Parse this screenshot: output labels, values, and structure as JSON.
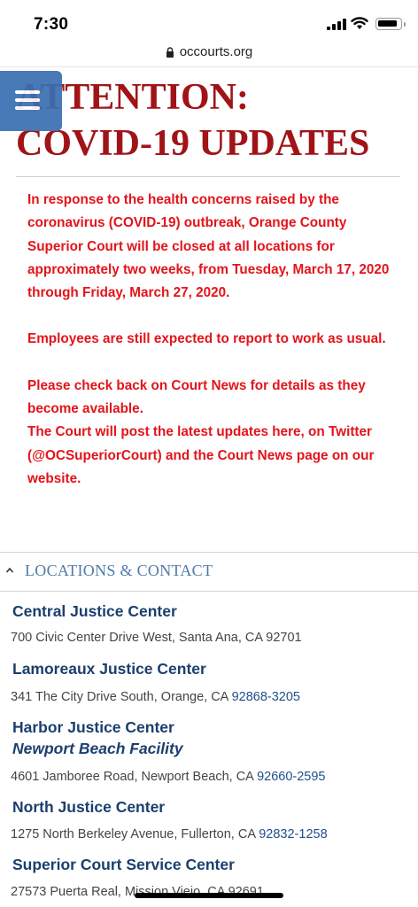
{
  "status_bar": {
    "time": "7:30"
  },
  "browser": {
    "url": "occourts.org"
  },
  "headline": {
    "line1": "ATTENTION:",
    "line2": "COVID-19 UPDATES"
  },
  "notice": {
    "paragraph1": "In response to the health concerns raised by the coronavirus (COVID-19) outbreak, Orange County Superior Court will be closed at all locations for approximately two weeks, from Tuesday, March 17, 2020 through Friday, March 27, 2020.",
    "paragraph2": "Employees are still expected to report to work as usual.",
    "paragraph3": "Please check back on Court News for details as they become available.",
    "paragraph4": "The Court will post the latest updates here, on Twitter (@OCSuperiorCourt) and the Court News page on our website."
  },
  "locations": {
    "title": "LOCATIONS & CONTACT",
    "items": [
      {
        "name": "Central Justice Center",
        "address": "700 Civic Center Drive West, Santa Ana, CA 92701",
        "zip_link": ""
      },
      {
        "name": "Lamoreaux Justice Center",
        "address": "341 The City Drive South, Orange, CA ",
        "zip_link": "92868-3205"
      },
      {
        "name": "Harbor Justice Center",
        "subtitle": "Newport Beach Facility",
        "address": "4601 Jamboree Road, Newport Beach, CA ",
        "zip_link": "92660-2595"
      },
      {
        "name": "North Justice Center",
        "address": "1275 North Berkeley Avenue, Fullerton, CA ",
        "zip_link": "92832-1258"
      },
      {
        "name": "Superior Court Service Center",
        "address": "27573 Puerta Real, Mission Viejo, CA 92691",
        "zip_link": ""
      }
    ]
  },
  "colors": {
    "headline": "#a01418",
    "notice": "#e3141b",
    "location_name": "#1b3f6e",
    "menu_button": "#3a6fb2"
  },
  "icons": [
    "signal-icon",
    "wifi-icon",
    "battery-icon",
    "lock-icon",
    "hamburger-menu-icon",
    "caret-up-icon"
  ]
}
